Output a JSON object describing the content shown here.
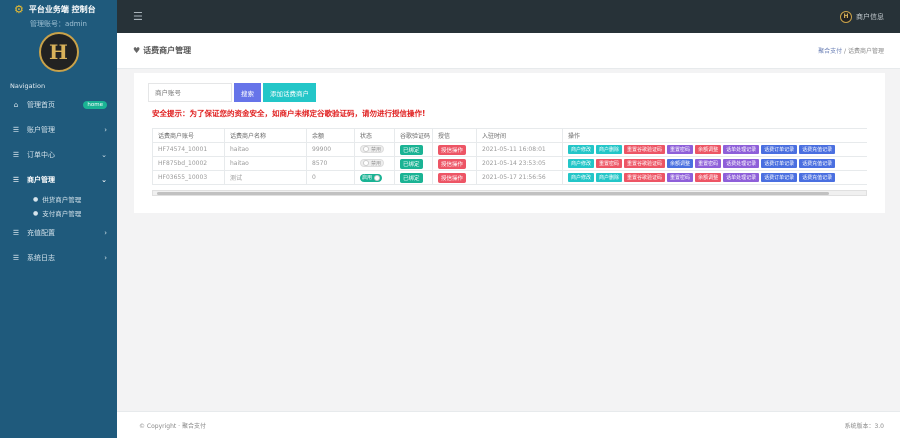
{
  "sidebar": {
    "brand": "平台业务端 控制台",
    "admin_line": "管理账号：admin",
    "nav_title": "Navigation",
    "items": [
      {
        "label": "管理首页",
        "icon": "home-icon",
        "badge": "home"
      },
      {
        "label": "账户管理",
        "icon": "list-icon"
      },
      {
        "label": "订单中心",
        "icon": "list-icon"
      },
      {
        "label": "商户管理",
        "icon": "list-icon"
      },
      {
        "label": "充值配置",
        "icon": "list-icon"
      },
      {
        "label": "系统日志",
        "icon": "list-icon"
      }
    ],
    "sub_items": [
      "供货商户管理",
      "支付商户管理"
    ]
  },
  "topbar": {
    "user_label": "商户信息"
  },
  "page": {
    "title": "话费商户管理",
    "breadcrumb_home": "聚合支付",
    "breadcrumb_sep": "/",
    "breadcrumb_current": "话费商户管理"
  },
  "toolbar": {
    "search_placeholder": "商户账号",
    "search_label": "搜索",
    "add_label": "添加话费商户"
  },
  "warning": "安全提示：为了保证您的资金安全，如商户未绑定谷歌验证码，请勿进行授信操作!",
  "table": {
    "headers": [
      "话费商户账号",
      "话费商户名称",
      "余额",
      "状态",
      "谷歌验证码",
      "授信",
      "入驻时间",
      "操作"
    ],
    "rows": [
      {
        "account": "HF74574_10001",
        "name": "haitao",
        "balance": "99900",
        "status": "禁用",
        "status_on": false,
        "google": "已绑定",
        "credit": "授信操作",
        "time": "2021-05-11 16:08:01"
      },
      {
        "account": "HF875bd_10002",
        "name": "haitao",
        "balance": "8570",
        "status": "禁用",
        "status_on": false,
        "google": "已绑定",
        "credit": "授信操作",
        "time": "2021-05-14 23:53:05"
      },
      {
        "account": "HF03655_10003",
        "name": "测试",
        "balance": "0",
        "status": "启用",
        "status_on": true,
        "google": "已绑定",
        "credit": "授信操作",
        "time": "2021-05-17 21:56:56"
      }
    ],
    "row_ops": [
      [
        "商户修改",
        "商户删除",
        "重置谷歌验证码",
        "重置密码",
        "余额调整",
        "话单处理记录",
        "话费订单记录",
        "话费充值记录"
      ],
      [
        "商户修改",
        "重置密码",
        "重置谷歌验证码",
        "余额调整",
        "重置密码",
        "话费处理记录",
        "话费订单记录",
        "话费充值记录"
      ],
      [
        "商户修改",
        "商户删除",
        "重置谷歌验证码",
        "重置密码",
        "余额调整",
        "话单处理记录",
        "话费订单记录",
        "话费充值记录"
      ]
    ]
  },
  "footer": {
    "copyright": "© Copyright · 聚合支付",
    "version": "系统版本：3.0"
  },
  "colors": {
    "sidebar_bg": "#1f5a7c",
    "topbar_bg": "#273238",
    "accent_teal": "#23c6c8",
    "accent_green": "#1ab394",
    "accent_red": "#ed5565",
    "accent_blue": "#6674e9",
    "warning": "#e02020"
  }
}
